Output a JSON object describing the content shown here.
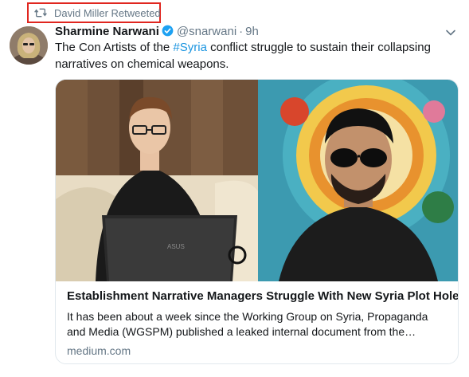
{
  "retweet": {
    "icon": "retweet-icon",
    "label": "David Miller Retweeted"
  },
  "tweet": {
    "author_name": "Sharmine Narwani",
    "verified_icon": "verified-badge-icon",
    "handle": "@snarwani",
    "separator": "·",
    "time": "9h",
    "menu_icon": "chevron-down-icon",
    "text_before": "The Con Artists of the ",
    "hashtag": "#Syria",
    "text_after": " conflict struggle to sustain their collapsing narratives on chemical weapons."
  },
  "card": {
    "title": "Establishment Narrative Managers Struggle With New Syria Plot Holes",
    "description": "It has been about a week since the Working Group on Syria, Propaganda and Media (WGSPM) published a leaked internal document from the…",
    "domain": "medium.com",
    "laptop_brand": "ASUS"
  },
  "colors": {
    "link": "#1b95e0",
    "secondary_text": "#657786",
    "highlight_border": "#e0261f",
    "card_border": "#e1e8ed"
  }
}
